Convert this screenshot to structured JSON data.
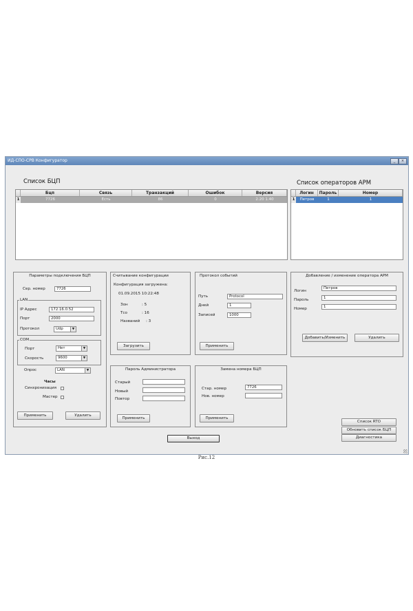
{
  "window": {
    "title": "ИД-СПО-СРВ Конфигуратор",
    "min_glyph": "_",
    "close_glyph": "×"
  },
  "bcp_list": {
    "title": "Список БЦП",
    "columns": [
      "Бцп",
      "Связь",
      "Транзакций",
      "Ошибок",
      "Версия"
    ],
    "rows": [
      {
        "num": "1",
        "cells": [
          "7726",
          "Есть",
          "86",
          "0",
          "2.20 1.40"
        ]
      }
    ]
  },
  "operators": {
    "title": "Список операторов АРМ",
    "columns": [
      "Логин",
      "Пароль",
      "Номер"
    ],
    "rows": [
      {
        "num": "1",
        "cells": [
          "Петров",
          "1",
          "1"
        ]
      }
    ]
  },
  "conn": {
    "title": "Параметры подключения БЦП",
    "serial_label": "Сер. номер",
    "serial_value": "7726",
    "lan_group": "LAN",
    "ip_label": "IP Адрес",
    "ip_value": "172.16.0.52",
    "port_label": "Порт",
    "port_value": "2000",
    "proto_label": "Протокол",
    "proto_value": "Udp",
    "com_group": "COM",
    "com_port_label": "Порт",
    "com_port_value": "Нет",
    "speed_label": "Скорость",
    "speed_value": "9600",
    "poll_label": "Опрос",
    "poll_value": "LAN",
    "clock_title": "Часы",
    "sync_label": "Синхронизация",
    "master_label": "Мастер",
    "apply": "Применить",
    "delete": "Удалить"
  },
  "config": {
    "title": "Считывание конфигурации",
    "loaded": "Конфигурация загружена:",
    "datetime": "01.09.2015 10:22:48",
    "zones_label": "Зон",
    "zones_value": ": 5",
    "tso_label": "Тсо",
    "tso_value": ": 16",
    "names_label": "Названий",
    "names_value": ": 3",
    "load": "Загрузить"
  },
  "events": {
    "title": "Протокол событий",
    "path_label": "Путь",
    "path_value": "Protocol",
    "days_label": "Дней",
    "days_value": "1",
    "records_label": "Записей",
    "records_value": "1000",
    "apply": "Применить"
  },
  "operator_edit": {
    "title": "Добавление / изменение оператора АРМ",
    "login_label": "Логин",
    "login_value": "Петров",
    "pass_label": "Пароль",
    "pass_value": "1",
    "num_label": "Номер",
    "num_value": "1",
    "add": "Добавить/Изменить",
    "delete": "Удалить"
  },
  "admin_pass": {
    "title": "Пароль Администратора",
    "old_label": "Старый",
    "new_label": "Новый",
    "repeat_label": "Повтор",
    "apply": "Применить"
  },
  "replace": {
    "title": "Замена номера БЦП",
    "old_label": "Стар. номер",
    "old_value": "7726",
    "new_label": "Нов. номер",
    "apply": "Применить"
  },
  "right_buttons": {
    "rto": "Список RTO",
    "refresh": "Обновить список БЦП",
    "diag": "Диагностика"
  },
  "exit": "Выход",
  "caption": "Рис.12"
}
